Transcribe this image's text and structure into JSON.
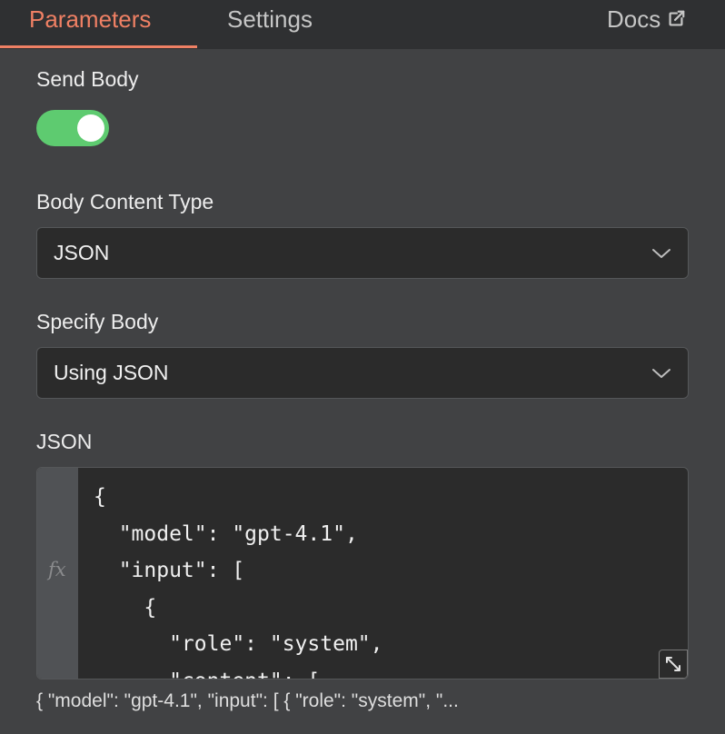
{
  "tabs": {
    "parameters": "Parameters",
    "settings": "Settings",
    "docs": "Docs"
  },
  "send_body": {
    "label": "Send Body",
    "enabled": true,
    "on_color": "#5ecb70"
  },
  "body_content_type": {
    "label": "Body Content Type",
    "value": "JSON"
  },
  "specify_body": {
    "label": "Specify Body",
    "value": "Using JSON"
  },
  "json_field": {
    "label": "JSON",
    "gutter_icon": "fx",
    "code_lines": [
      "{",
      "  \"model\": \"gpt-4.1\",",
      "  \"input\": [",
      "    {",
      "      \"role\": \"system\",",
      "      \"content\": ["
    ],
    "preview": "{   \"model\": \"gpt-4.1\",   \"input\": [    {       \"role\": \"system\",       \"..."
  },
  "colors": {
    "accent": "#ef8064",
    "background": "#414244",
    "field_bg": "#2b2b2b"
  }
}
